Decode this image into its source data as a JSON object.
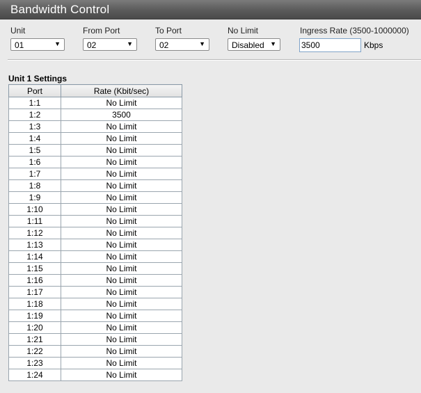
{
  "page": {
    "title": "Bandwidth Control"
  },
  "form": {
    "unit": {
      "label": "Unit",
      "value": "01"
    },
    "from_port": {
      "label": "From Port",
      "value": "02"
    },
    "to_port": {
      "label": "To Port",
      "value": "02"
    },
    "no_limit": {
      "label": "No Limit",
      "value": "Disabled"
    },
    "ingress_rate": {
      "label": "Ingress Rate (3500-1000000)",
      "value": "3500",
      "unit": "Kbps"
    }
  },
  "settings": {
    "title": "Unit 1 Settings",
    "columns": [
      "Port",
      "Rate (Kbit/sec)"
    ],
    "rows": [
      {
        "port": "1:1",
        "rate": "No Limit"
      },
      {
        "port": "1:2",
        "rate": "3500"
      },
      {
        "port": "1:3",
        "rate": "No Limit"
      },
      {
        "port": "1:4",
        "rate": "No Limit"
      },
      {
        "port": "1:5",
        "rate": "No Limit"
      },
      {
        "port": "1:6",
        "rate": "No Limit"
      },
      {
        "port": "1:7",
        "rate": "No Limit"
      },
      {
        "port": "1:8",
        "rate": "No Limit"
      },
      {
        "port": "1:9",
        "rate": "No Limit"
      },
      {
        "port": "1:10",
        "rate": "No Limit"
      },
      {
        "port": "1:11",
        "rate": "No Limit"
      },
      {
        "port": "1:12",
        "rate": "No Limit"
      },
      {
        "port": "1:13",
        "rate": "No Limit"
      },
      {
        "port": "1:14",
        "rate": "No Limit"
      },
      {
        "port": "1:15",
        "rate": "No Limit"
      },
      {
        "port": "1:16",
        "rate": "No Limit"
      },
      {
        "port": "1:17",
        "rate": "No Limit"
      },
      {
        "port": "1:18",
        "rate": "No Limit"
      },
      {
        "port": "1:19",
        "rate": "No Limit"
      },
      {
        "port": "1:20",
        "rate": "No Limit"
      },
      {
        "port": "1:21",
        "rate": "No Limit"
      },
      {
        "port": "1:22",
        "rate": "No Limit"
      },
      {
        "port": "1:23",
        "rate": "No Limit"
      },
      {
        "port": "1:24",
        "rate": "No Limit"
      }
    ]
  }
}
